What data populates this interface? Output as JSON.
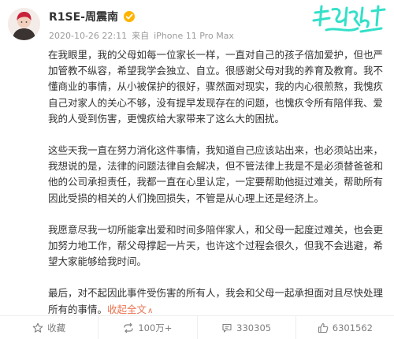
{
  "post": {
    "author": "R1SE-周震南",
    "date": "2020-10-26 22:11",
    "source_prefix": "来自",
    "device": "iPhone 11 Pro Max",
    "paragraphs": [
      "在我眼里，我的父母如每一位家长一样，一直对自己的孩子倍加爱护，但也严加管教不纵容，希望我学会独立、自立。很感谢父母对我的养育及教育。我不懂商业的事情，从小被保护的很好，骤然面对现实，我的内心很煎熬，我愧疚自己对家人的关心不够，没有提早发现存在的问题，也愧疚令所有陪伴我、爱我的人受到伤害，更愧疚给大家带来了这么大的困扰。",
      "这些天我一直在努力消化这件事情，我知道自己应该站出来，也必须站出来，我想说的是，法律的问题法律自会解决，但不管法律上我是不是必须替爸爸和他的公司承担责任，我都一直在心里认定，一定要帮助他挺过难关，帮助所有因此受损的相关的人们挽回损失，不管是从心理上还是经济上。",
      "我愿意尽我一切所能拿出爱和时间多陪伴家人，和父母一起度过难关，也会更加努力地工作，帮父母撑起一片天，也许这个过程会很久，但我不会逃避，希望大家能够给我时间。",
      "最后，对不起因此事件受伤害的所有人，我会和父母一起承担面对且尽快处理所有的事情。"
    ],
    "expand_label": "收起全文",
    "expand_chevron": "∧"
  },
  "actions": {
    "favorite_label": "收藏",
    "repost_count": "100万+",
    "comment_count": "330305",
    "like_count": "6301562"
  },
  "colors": {
    "link_orange": "#eb7350",
    "deco_teal": "#33e0c8"
  },
  "icons": {
    "avatar": "avatar-photo",
    "badge": "vip-badge-icon",
    "favorite": "star-icon",
    "repost": "repost-icon",
    "comment": "comment-icon",
    "like": "thumbs-up-icon",
    "brand": "brand-script-decoration"
  }
}
